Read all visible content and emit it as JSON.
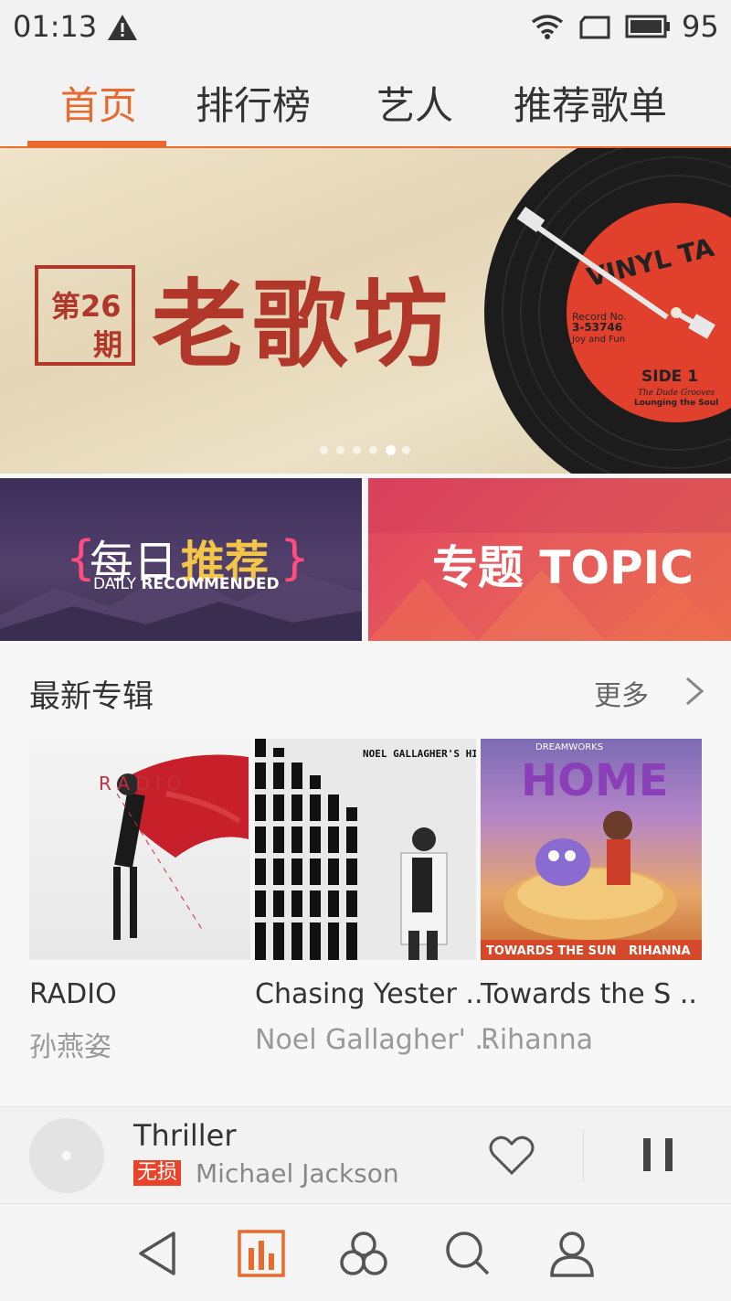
{
  "status": {
    "time": "01:13",
    "battery": "95"
  },
  "tabs": [
    {
      "label": "首页",
      "active": true
    },
    {
      "label": "排行榜",
      "active": false
    },
    {
      "label": "艺人",
      "active": false
    },
    {
      "label": "推荐歌单",
      "active": false
    }
  ],
  "banner": {
    "issue_prefix": "第",
    "issue_number": "26",
    "issue_suffix": "期",
    "title": "老歌坊",
    "record_label_top": "VINYL TA",
    "record_side": "SIDE 1",
    "record_subtitle": "The Dude Grooves",
    "record_tagline": "Lounging the Soul",
    "record_number_label": "Record No.",
    "record_number": "3-53746",
    "record_small": "Joy and Fun",
    "page_count": 6,
    "active_page": 5
  },
  "cards": {
    "daily": {
      "cn_a": "每日",
      "cn_b": "推荐",
      "en_a": "DAILY ",
      "en_b": "RECOMMENDED"
    },
    "topic": {
      "label": "专题 TOPIC"
    }
  },
  "section": {
    "title": "最新专辑",
    "more": "更多"
  },
  "albums": [
    {
      "title": "RADIO",
      "artist": "孙燕姿",
      "art_text": "R A D I O"
    },
    {
      "title": "Chasing Yester ..",
      "artist": "Noel Gallagher' ..",
      "art_text": "NOEL GALLAGHER'S HIGH FLYING BIRDS"
    },
    {
      "title": "Towards the S ..",
      "artist": "Rihanna",
      "art_text": "HOME",
      "art_caption": "TOWARDS THE SUN",
      "art_caption2": "RIHANNA",
      "art_brand": "DREAMWORKS"
    }
  ],
  "player": {
    "song": "Thriller",
    "badge": "无损",
    "artist": "Michael Jackson"
  },
  "nav": [
    "back-icon",
    "charts-icon",
    "discover-icon",
    "search-icon",
    "profile-icon"
  ],
  "colors": {
    "accent": "#e96a2c",
    "banner_red": "#b0372a",
    "badge": "#e9442a"
  }
}
